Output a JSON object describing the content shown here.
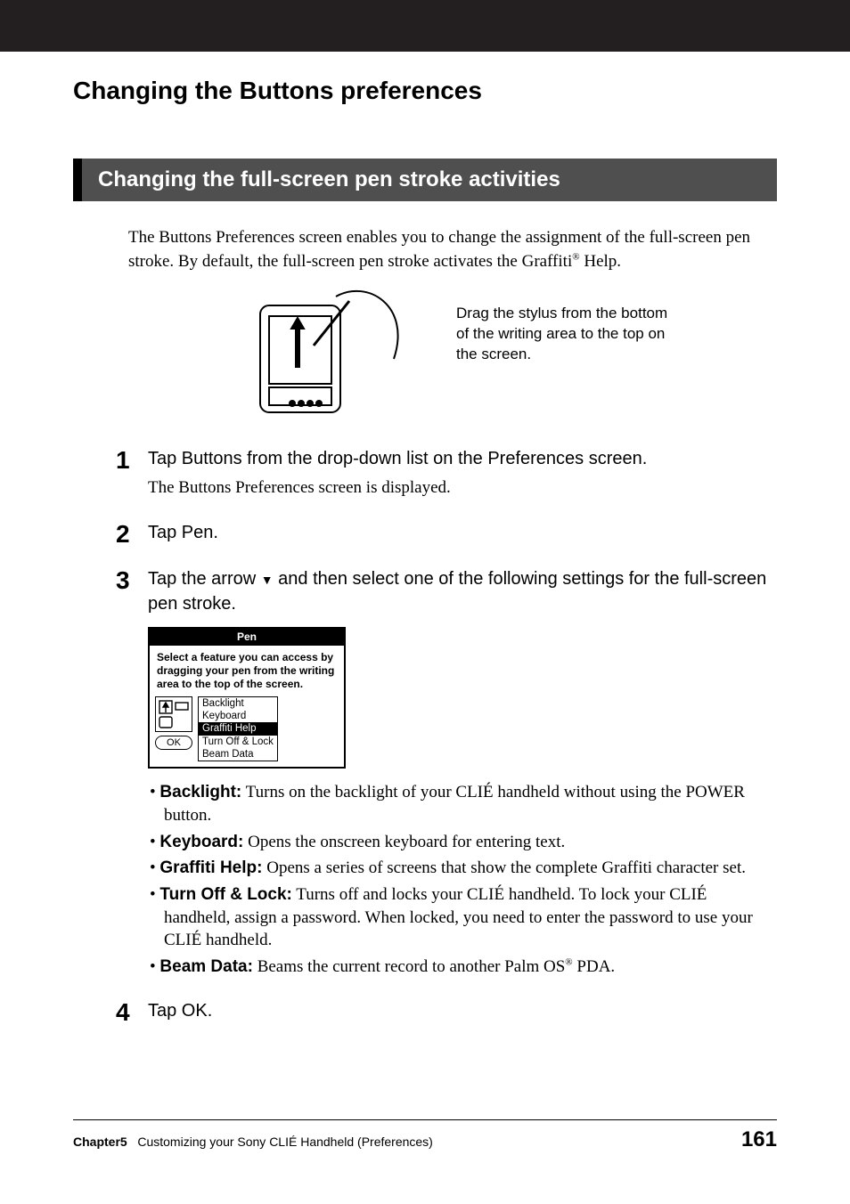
{
  "section_title": "Changing the Buttons preferences",
  "subsection_title": "Changing the full-screen pen stroke activities",
  "intro": {
    "t1": "The Buttons Preferences screen enables you to change the assignment of the full-screen pen stroke. By default, the full-screen pen stroke activates the Graffiti",
    "sup": "®",
    "t2": " Help."
  },
  "figure_caption": "Drag the stylus from the bottom of the writing area to the top on the screen.",
  "steps": {
    "s1": {
      "num": "1",
      "head": "Tap Buttons from the drop-down list on the Preferences screen.",
      "sub": "The Buttons Preferences screen is displayed."
    },
    "s2": {
      "num": "2",
      "head": "Tap Pen."
    },
    "s3": {
      "num": "3",
      "head_a": "Tap the arrow ",
      "head_tri": "▼",
      "head_b": " and then select one of the following settings for the full-screen pen stroke."
    },
    "s4": {
      "num": "4",
      "head": "Tap OK."
    }
  },
  "screenshot": {
    "title": "Pen",
    "text": "Select a feature you can access by dragging your pen from the writing area to the top of the screen.",
    "ok": "OK",
    "options": {
      "o0": "Backlight",
      "o1": "Keyboard",
      "o2": "Graffiti Help",
      "o3": "Turn Off & Lock",
      "o4": "Beam Data"
    }
  },
  "bullets": {
    "b0": {
      "label": "Backlight:",
      "text": " Turns on the backlight of your CLIÉ handheld without using the POWER button."
    },
    "b1": {
      "label": "Keyboard:",
      "text": " Opens the onscreen keyboard for entering text."
    },
    "b2": {
      "label": "Graffiti Help:",
      "text": " Opens a series of screens that show the complete Graffiti character set."
    },
    "b3": {
      "label": "Turn Off & Lock:",
      "text": " Turns off and locks your CLIÉ handheld. To lock your CLIÉ handheld, assign a password. When locked, you need to enter the password to use your CLIÉ handheld."
    },
    "b4": {
      "label": "Beam Data:",
      "text_a": " Beams the current record to another Palm OS",
      "sup": "®",
      "text_b": " PDA."
    }
  },
  "footer": {
    "chapter": "Chapter5",
    "subtitle": "Customizing your Sony CLIÉ Handheld (Preferences)",
    "page": "161"
  }
}
